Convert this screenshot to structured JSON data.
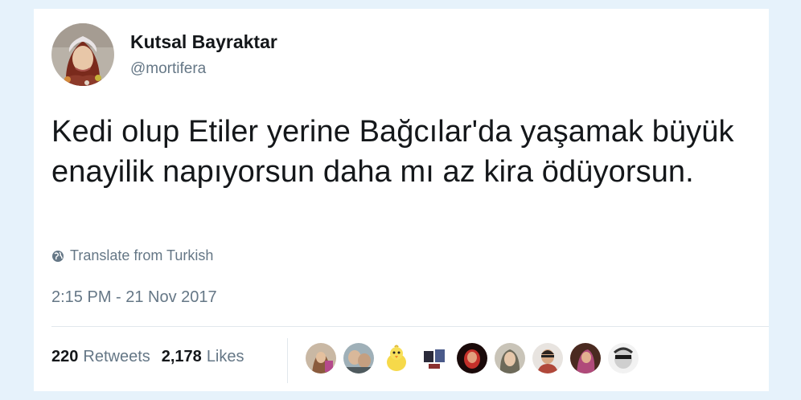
{
  "author": {
    "name": "Kutsal Bayraktar",
    "handle": "@mortifera"
  },
  "tweet": {
    "text": "Kedi olup Etiler yerine Bağcılar'da yaşamak büyük enayilik napıyorsun daha mı az kira ödüyorsun.",
    "translate_label": "Translate from Turkish",
    "timestamp": "2:15 PM - 21 Nov 2017"
  },
  "stats": {
    "retweets_count": "220",
    "retweets_label": "Retweets",
    "likes_count": "2,178",
    "likes_label": "Likes"
  },
  "likers": [
    {
      "icon": "liker-avatar-1"
    },
    {
      "icon": "liker-avatar-2"
    },
    {
      "icon": "liker-avatar-3-chick"
    },
    {
      "icon": "liker-avatar-4"
    },
    {
      "icon": "liker-avatar-5"
    },
    {
      "icon": "liker-avatar-6"
    },
    {
      "icon": "liker-avatar-7"
    },
    {
      "icon": "liker-avatar-8"
    },
    {
      "icon": "liker-avatar-9"
    }
  ],
  "colors": {
    "page_background": "#e6f2fb",
    "card_background": "#ffffff",
    "primary_text": "#14171a",
    "secondary_text": "#657786",
    "divider": "#e1e8ed"
  }
}
